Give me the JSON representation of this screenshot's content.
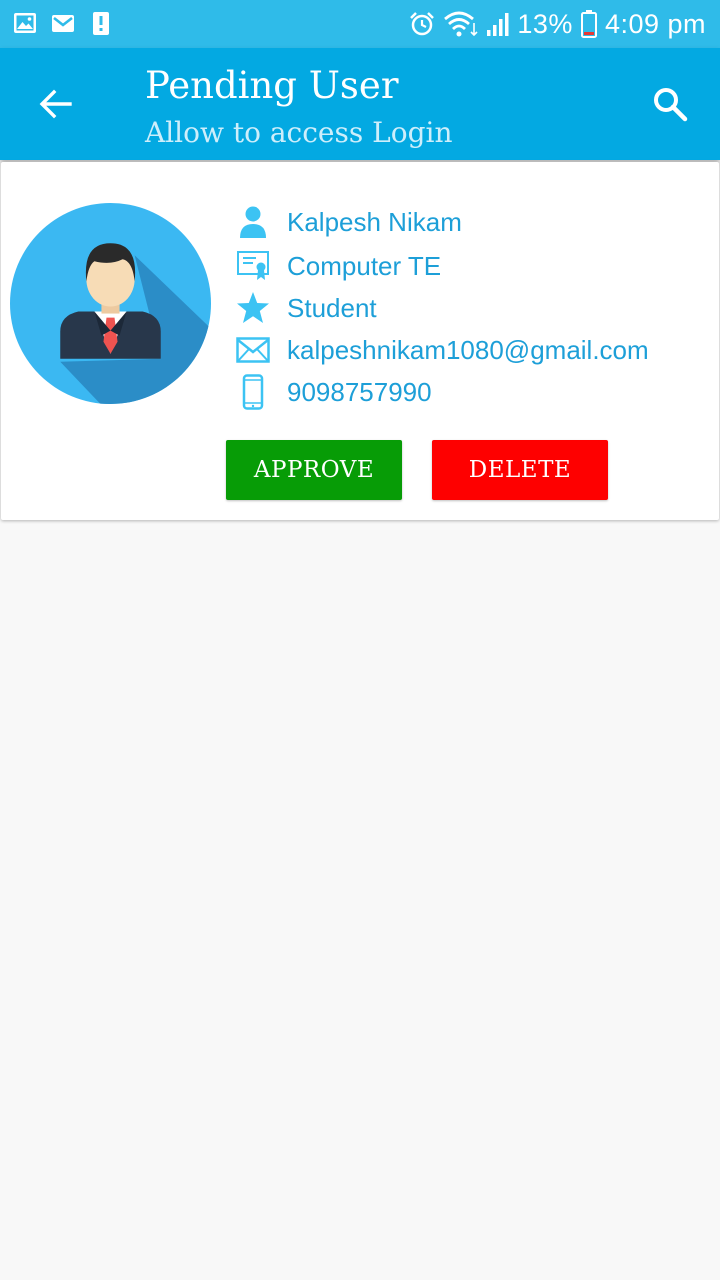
{
  "status_bar": {
    "battery": "13%",
    "time": "4:09 pm",
    "left_icons": [
      "gallery-icon",
      "gmail-icon",
      "alert-icon"
    ],
    "right_icons": [
      "alarm-icon",
      "wifi-icon",
      "signal-icon",
      "battery-icon"
    ]
  },
  "app_bar": {
    "title": "Pending User",
    "subtitle": "Allow to access Login",
    "back_icon": "arrow-back-icon",
    "search_icon": "search-icon"
  },
  "user_card": {
    "avatar_icon": "businessman-avatar-icon",
    "name": "Kalpesh Nikam",
    "department": "Computer TE",
    "role": "Student",
    "email": "kalpeshnikam1080@gmail.com",
    "phone": "9098757990",
    "approve_label": "APPROVE",
    "delete_label": "DELETE"
  },
  "colors": {
    "status_bar": "#2fbbe9",
    "app_bar": "#03a9e2",
    "accent_text": "#1d9fd8",
    "icon": "#3cc3f3",
    "approve": "#079c06",
    "delete": "#fe0000",
    "background": "#f8f8f8"
  }
}
